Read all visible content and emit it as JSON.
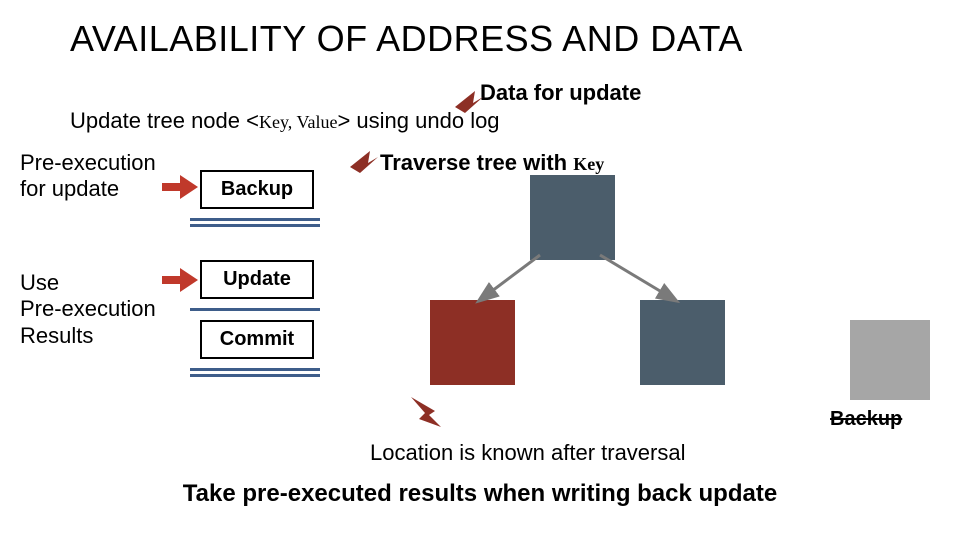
{
  "title": "AVAILABILITY OF ADDRESS AND DATA",
  "callout_data": "Data for update",
  "update_line_pre": "Update tree node <",
  "update_line_kv": "Key, Value",
  "update_line_post": "> using undo log",
  "traverse_pre": "Traverse tree with ",
  "traverse_key": "Key",
  "preexec_l1": "Pre-execution",
  "preexec_l2": "for update",
  "use_l1": "Use",
  "use_l2": "Pre-execution",
  "use_l3": "Results",
  "boxes": {
    "backup": "Backup",
    "update": "Update",
    "commit": "Commit"
  },
  "backup_node_label": "Backup",
  "location_line": "Location is known after traversal",
  "bottom_line": "Take pre-executed results when writing back update",
  "colors": {
    "node_gray": "#4b5d6b",
    "node_red": "#8d2f25",
    "arrow_dark_red": "#8d2f25",
    "arrow_red": "#c0392b",
    "rule_blue": "#3e5d8a",
    "backup_gray": "#a6a6a6"
  }
}
